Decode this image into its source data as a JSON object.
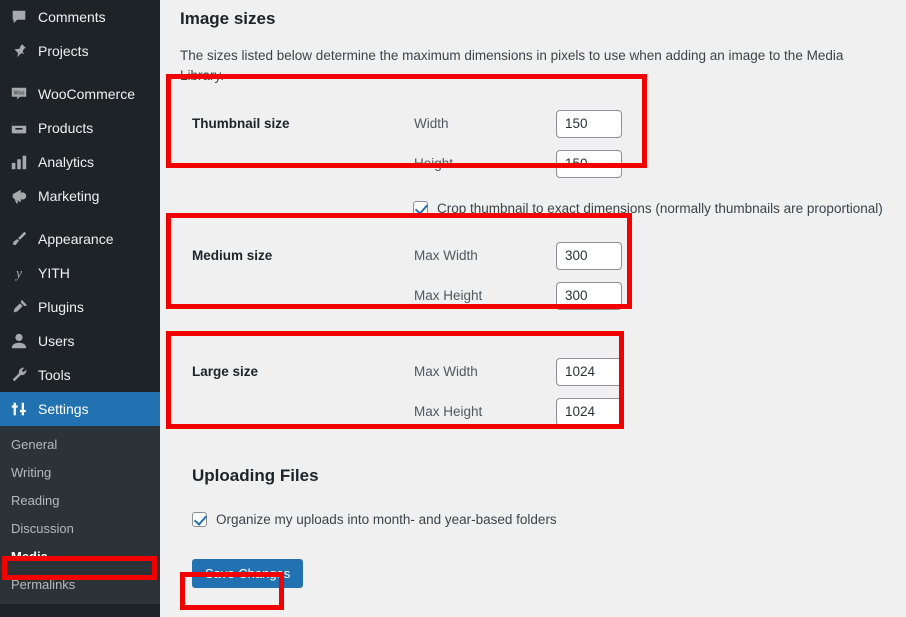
{
  "sidebar": {
    "items": [
      {
        "label": "Comments",
        "icon": "comments-icon"
      },
      {
        "label": "Projects",
        "icon": "pushpin-icon"
      },
      {
        "label": "WooCommerce",
        "icon": "woocommerce-icon"
      },
      {
        "label": "Products",
        "icon": "products-box-icon"
      },
      {
        "label": "Analytics",
        "icon": "bar-chart-icon"
      },
      {
        "label": "Marketing",
        "icon": "megaphone-icon"
      },
      {
        "label": "Appearance",
        "icon": "paintbrush-icon"
      },
      {
        "label": "YITH",
        "icon": "yith-icon"
      },
      {
        "label": "Plugins",
        "icon": "plug-icon"
      },
      {
        "label": "Users",
        "icon": "user-icon"
      },
      {
        "label": "Tools",
        "icon": "wrench-icon"
      },
      {
        "label": "Settings",
        "icon": "sliders-icon"
      }
    ],
    "submenu": [
      {
        "label": "General"
      },
      {
        "label": "Writing"
      },
      {
        "label": "Reading"
      },
      {
        "label": "Discussion"
      },
      {
        "label": "Media"
      },
      {
        "label": "Permalinks"
      }
    ]
  },
  "main": {
    "image_sizes_title": "Image sizes",
    "image_sizes_desc": "The sizes listed below determine the maximum dimensions in pixels to use when adding an image to the Media Library.",
    "sizes": [
      {
        "title": "Thumbnail size",
        "fields": [
          {
            "label": "Width",
            "value": "150"
          },
          {
            "label": "Height",
            "value": "150"
          }
        ]
      },
      {
        "title": "Medium size",
        "fields": [
          {
            "label": "Max Width",
            "value": "300"
          },
          {
            "label": "Max Height",
            "value": "300"
          }
        ]
      },
      {
        "title": "Large size",
        "fields": [
          {
            "label": "Max Width",
            "value": "1024"
          },
          {
            "label": "Max Height",
            "value": "1024"
          }
        ]
      }
    ],
    "crop_checkbox": {
      "label": "Crop thumbnail to exact dimensions (normally thumbnails are proportional)",
      "checked": true
    },
    "uploading_files_title": "Uploading Files",
    "organize_checkbox": {
      "label": "Organize my uploads into month- and year-based folders",
      "checked": true
    },
    "save_label": "Save Changes"
  },
  "colors": {
    "sidebar_bg": "#1d2327",
    "submenu_bg": "#2c3338",
    "accent_blue": "#2271b1",
    "page_bg": "#f0f0f1",
    "annotation_red": "#f20000"
  }
}
